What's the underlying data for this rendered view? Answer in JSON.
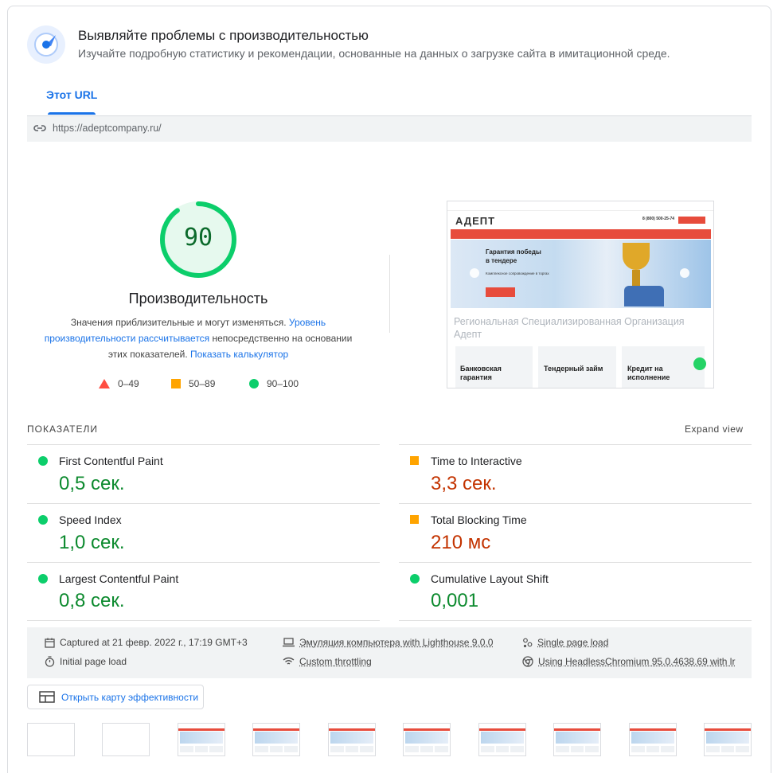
{
  "header": {
    "title": "Выявляйте проблемы с производительностью",
    "subtitle": "Изучайте подробную статистику и рекомендации, основанные на данных о загрузке сайта в имитационной среде."
  },
  "tabs": [
    {
      "label": "Этот URL"
    }
  ],
  "url": "https://adeptcompany.ru/",
  "performance": {
    "score": "90",
    "score_value": 90,
    "title": "Производительность",
    "desc_1": "Значения приблизительные и могут изменяться. ",
    "desc_link_1": "Уровень производительности рассчитывается",
    "desc_2": " непосредственно на основании этих показателей. ",
    "desc_link_2": "Показать калькулятор"
  },
  "legend": [
    {
      "range": "0–49",
      "color": "#ff4e42"
    },
    {
      "range": "50–89",
      "color": "#ffa400"
    },
    {
      "range": "90–100",
      "color": "#0cce6b"
    }
  ],
  "screenshot": {
    "logo": "АДЕПТ",
    "phone": "8 (800) 500-25-74",
    "hero_text_1": "Гарантия победы",
    "hero_text_2": "в тендере",
    "hero_sub": "Комплексное сопровождение в торгах",
    "heading": "Региональная Специализированная Организация Адепт",
    "cards": [
      "Банковская гарантия",
      "Тендерный займ",
      "Кредит на исполнение"
    ]
  },
  "metrics": {
    "label": "ПОКАЗАТЕЛИ",
    "expand": "Expand view",
    "items": [
      {
        "name": "First Contentful Paint",
        "value": "0,5 сек.",
        "status": "good"
      },
      {
        "name": "Time to Interactive",
        "value": "3,3 сек.",
        "status": "average"
      },
      {
        "name": "Speed Index",
        "value": "1,0 сек.",
        "status": "good"
      },
      {
        "name": "Total Blocking Time",
        "value": "210 мс",
        "status": "average"
      },
      {
        "name": "Largest Contentful Paint",
        "value": "0,8 сек.",
        "status": "good"
      },
      {
        "name": "Cumulative Layout Shift",
        "value": "0,001",
        "status": "good"
      }
    ]
  },
  "run_info": {
    "captured": "Captured at 21 февр. 2022 г., 17:19 GMT+3",
    "initial": "Initial page load",
    "emulation": "Эмуляция компьютера with Lighthouse 9.0.0",
    "throttling": "Custom throttling",
    "single": "Single page load",
    "browser": "Using HeadlessChromium 95.0.4638.69 with lr"
  },
  "treemap_button": "Открыть карту эффективности"
}
